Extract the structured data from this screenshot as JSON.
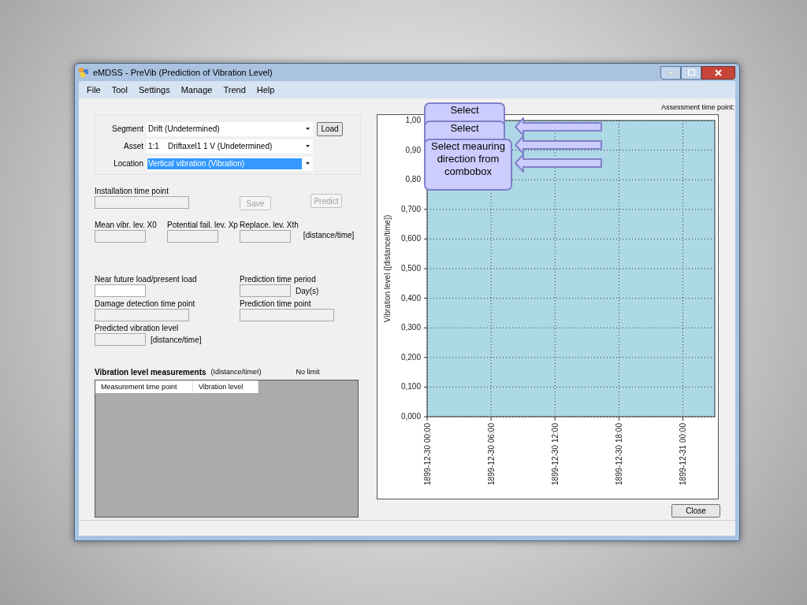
{
  "window": {
    "title": "eMDSS - PreVib (Prediction of Vibration Level)"
  },
  "menu": [
    "File",
    "Tool",
    "Settings",
    "Manage",
    "Trend",
    "Help"
  ],
  "selection": [
    {
      "label": "Segment",
      "value": "Drift (Undetermined)",
      "selected": false
    },
    {
      "label": "Asset",
      "value": "1:1    Driftaxel1 1 V (Undetermined)",
      "selected": false
    },
    {
      "label": "Location",
      "value": "Vertical vibration (Vibration)",
      "selected": true
    }
  ],
  "load_button": "Load",
  "installation": {
    "label": "Installation time point",
    "disabled": true
  },
  "buttons": [
    {
      "label": "Save",
      "disabled": true
    },
    {
      "label": "Predict",
      "disabled": true
    }
  ],
  "levels": [
    {
      "label": "Mean vibr. lev. X0",
      "disabled": true
    },
    {
      "label": "Potential fail. lev. Xp",
      "disabled": true
    },
    {
      "label": "Replace. lev. Xth",
      "disabled": true
    }
  ],
  "levels_unit": "[distance/time]",
  "load_ratio": {
    "label": "Near future load/present load",
    "disabled": false
  },
  "prediction_period": {
    "label": "Prediction time period",
    "unit": "Day(s)",
    "disabled": true
  },
  "damage_detection": {
    "label": "Damage detection time point",
    "disabled": true
  },
  "prediction_time_point": {
    "label": "Prediction time point",
    "disabled": true
  },
  "predicted_level": {
    "label": "Predicted vibration level",
    "unit": "[distance/time]",
    "disabled": true
  },
  "measurements": {
    "title": "Vibration level measurements",
    "unit": "(Idistance/timeI)",
    "limit": "No limit",
    "columns": [
      "Measurement time point",
      "Vibration level"
    ]
  },
  "assessment_label": "Assessment time point:",
  "chart_data": {
    "type": "line",
    "ylabel": "Vibration level ([distance/time])",
    "ylim": [
      0,
      1
    ],
    "grid": true,
    "yticks": [
      {
        "value": 0,
        "label": "0,000"
      },
      {
        "value": 0.1,
        "label": "0,100"
      },
      {
        "value": 0.2,
        "label": "0,200"
      },
      {
        "value": 0.3,
        "label": "0,300"
      },
      {
        "value": 0.4,
        "label": "0,400"
      },
      {
        "value": 0.5,
        "label": "0,500"
      },
      {
        "value": 0.6,
        "label": "0,600"
      },
      {
        "value": 0.7,
        "label": "0,700"
      },
      {
        "value": 0.8,
        "label": "0,80"
      },
      {
        "value": 0.9,
        "label": "0,90"
      },
      {
        "value": 1,
        "label": "1,00"
      }
    ],
    "categories": [
      "1899-12-30 00:00",
      "1899-12-30 06:00",
      "1899-12-30 12:00",
      "1899-12-30 18:00",
      "1899-12-31 00:00"
    ]
  },
  "callouts": [
    "Select",
    "Select",
    "Select meauring direction from combobox"
  ],
  "close_button": "Close"
}
